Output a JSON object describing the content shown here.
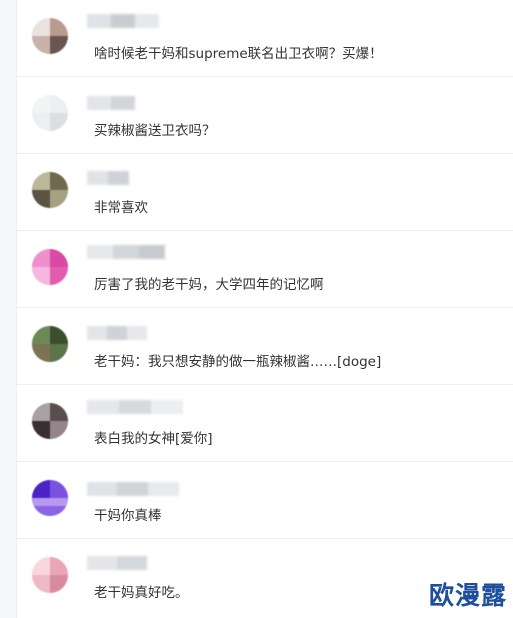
{
  "comments": [
    {
      "text": "啥时候老干妈和supreme联名出卫衣啊？买爆！"
    },
    {
      "text": "买辣椒酱送卫衣吗？"
    },
    {
      "text": "非常喜欢"
    },
    {
      "text": "厉害了我的老干妈，大学四年的记忆啊"
    },
    {
      "text": "老干妈：我只想安静的做一瓶辣椒酱……[doge]"
    },
    {
      "text": "表白我的女神[爱你]"
    },
    {
      "text": "干妈你真棒"
    },
    {
      "text": "老干妈真好吃。"
    }
  ],
  "watermark": "欧漫露",
  "colors": {
    "watermark": "#1d4f9c",
    "divider": "#eef0f3",
    "rail": "#f6f7f9"
  }
}
